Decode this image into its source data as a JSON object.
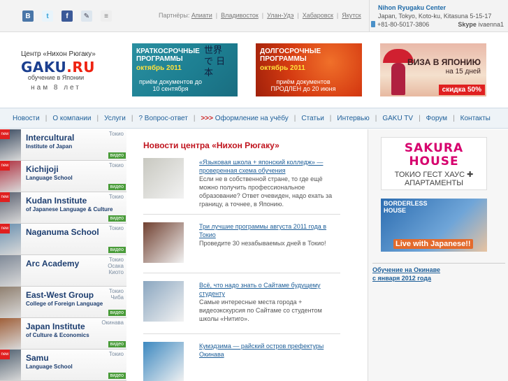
{
  "topbar": {
    "partners_label": "Партнёры:",
    "partners": [
      "Апиати",
      "Владивосток",
      "Улан-Удэ",
      "Хабаровск",
      "Якутск"
    ],
    "social": [
      {
        "icon": "vk-icon",
        "glyph": "В"
      },
      {
        "icon": "twitter-icon",
        "glyph": "t"
      },
      {
        "icon": "facebook-icon",
        "glyph": "f"
      },
      {
        "icon": "livejournal-icon",
        "glyph": "✎"
      },
      {
        "icon": "rss-icon",
        "glyph": "≡"
      }
    ]
  },
  "contact": {
    "name": "Nihon Ryugaku Center",
    "address": "Japan, Tokyo, Koto-ku, Kitasuna 5-15-17",
    "phone": "+81-80-5017-3806",
    "skype_label": "Skype",
    "skype": "ivaenna1"
  },
  "logo": {
    "caption": "Центр «Нихон Рюгаку»",
    "main": "GAKU",
    "tld": ".RU",
    "sub": "обучение в Японии",
    "years": "нам 8 лет"
  },
  "banners": {
    "short": {
      "title": "Краткосрочные программы",
      "date": "октябрь 2011",
      "info": "приём документов до 10 сентября",
      "kanji": "世界 で 日本"
    },
    "long": {
      "title": "Долгосрочные программы",
      "date": "октябрь 2011",
      "info": "приём документов ПРОДЛЕН до 20 июня"
    },
    "visa": {
      "title": "ВИЗА В ЯПОНИЮ",
      "days": "на 15 дней",
      "sale": "скидка 50%"
    }
  },
  "nav": {
    "items": [
      {
        "label": "Новости"
      },
      {
        "label": "О компании"
      },
      {
        "label": "Услуги"
      },
      {
        "label": "? Вопрос-ответ"
      },
      {
        "label": "Оформление на учёбу",
        "prefix": ">>>"
      },
      {
        "label": "Статьи"
      },
      {
        "label": "Интервью"
      },
      {
        "label": "GAKU TV"
      },
      {
        "label": "Форум"
      },
      {
        "label": "Контакты"
      }
    ]
  },
  "schools": [
    {
      "name": "Intercultural",
      "name2": "Institute of Japan",
      "city": "Токио",
      "video": "видео",
      "new": "new",
      "color": "#3a4a60"
    },
    {
      "name": "Kichijoji",
      "name2": "Language School",
      "city": "Токио",
      "video": "видео",
      "new": "new",
      "color": "#b03040"
    },
    {
      "name": "Kudan Institute",
      "name2": "of Japanese Language & Culture",
      "city": "Токио",
      "video": "видео",
      "new": "new",
      "color": "#5a6070"
    },
    {
      "name": "Naganuma School",
      "name2": "",
      "city": "Токио",
      "video": "видео",
      "new": "new",
      "color": "#6a90b0"
    },
    {
      "name": "Arc  Academy",
      "name2": "",
      "city": "Токио\nОсака\nКиото",
      "video": "",
      "new": "",
      "color": "#808a98"
    },
    {
      "name": "East-West Group",
      "name2": "College of Foreign Language",
      "city": "Токио\nЧиба",
      "video": "видео",
      "new": "",
      "color": "#908070"
    },
    {
      "name": "Japan Institute",
      "name2": "of Culture & Economics",
      "city": "Окинава",
      "video": "видео",
      "new": "",
      "color": "#a0603a"
    },
    {
      "name": "Samu",
      "name2": "Language School",
      "city": "Токио",
      "video": "видео",
      "new": "new",
      "color": "#506070"
    }
  ],
  "news": {
    "heading": "Новости центра «Нихон Рюгаку»",
    "items": [
      {
        "title": "«Языковая школа + японский колледж» — проверенная схема обучения",
        "text": "Если не в собственной стране, то где ещё можно получить профессиональное образование? Ответ очевиден, надо ехать за границу, а точнее, в Японию.",
        "color": "#c8c8c0"
      },
      {
        "title": "Три лучшие программы августа 2011 года в Токио",
        "text": "Проведите 30 незабываемых дней в Токио!",
        "color": "#704030"
      },
      {
        "title": "Всё, что надо знать о Сайтаме будущему студенту",
        "text": "Самые интересные места города + видеоэкскурсия по Сайтаме со студентом школы «Нитиго».",
        "color": "#8aa6c0"
      },
      {
        "title": "Кумэдзима — райский остров префектуры Окинава",
        "text": "",
        "color": "#3c88c0"
      }
    ]
  },
  "right": {
    "sakura_title": "SAKURA HOUSE",
    "sakura_sub": "ТОКИО ГЕСТ ХАУС ✚ АПАРТАМЕНТЫ",
    "border_title": "BORDERLESS HOUSE",
    "border_sub": "Live with Japanese!!",
    "okinawa_1": "Обучение на Окинаве",
    "okinawa_2": "с января 2012 года"
  }
}
